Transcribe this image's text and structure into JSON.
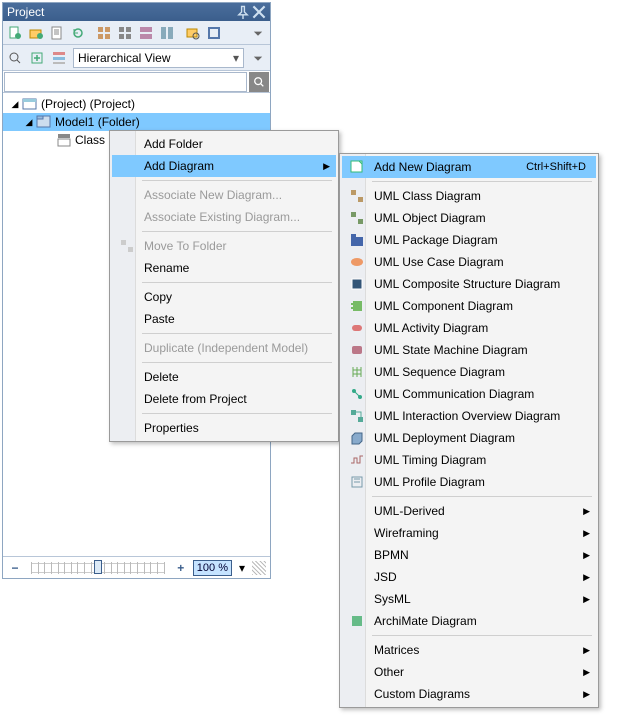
{
  "title": "Project",
  "view_selector": "Hierarchical View",
  "zoom_label": "100 %",
  "tree": {
    "root": "(Project) (Project)",
    "folder": "Model1 (Folder)",
    "class": "Class"
  },
  "menu1": {
    "add_folder": "Add Folder",
    "add_diagram": "Add Diagram",
    "assoc_new": "Associate New Diagram...",
    "assoc_exist": "Associate Existing Diagram...",
    "move_to": "Move To Folder",
    "rename": "Rename",
    "copy": "Copy",
    "paste": "Paste",
    "dup": "Duplicate (Independent Model)",
    "delete": "Delete",
    "del_proj": "Delete from Project",
    "props": "Properties"
  },
  "menu2": {
    "new": "Add New Diagram",
    "new_sc": "Ctrl+Shift+D",
    "uml_class": "UML Class Diagram",
    "uml_object": "UML Object Diagram",
    "uml_package": "UML Package Diagram",
    "uml_usecase": "UML Use Case Diagram",
    "uml_compstruct": "UML Composite Structure Diagram",
    "uml_component": "UML Component Diagram",
    "uml_activity": "UML Activity Diagram",
    "uml_state": "UML State Machine Diagram",
    "uml_seq": "UML Sequence Diagram",
    "uml_comm": "UML Communication Diagram",
    "uml_inter": "UML Interaction Overview Diagram",
    "uml_deploy": "UML Deployment Diagram",
    "uml_timing": "UML Timing Diagram",
    "uml_profile": "UML Profile Diagram",
    "uml_derived": "UML-Derived",
    "wireframing": "Wireframing",
    "bpmn": "BPMN",
    "jsd": "JSD",
    "sysml": "SysML",
    "archimate": "ArchiMate Diagram",
    "matrices": "Matrices",
    "other": "Other",
    "custom": "Custom Diagrams"
  }
}
